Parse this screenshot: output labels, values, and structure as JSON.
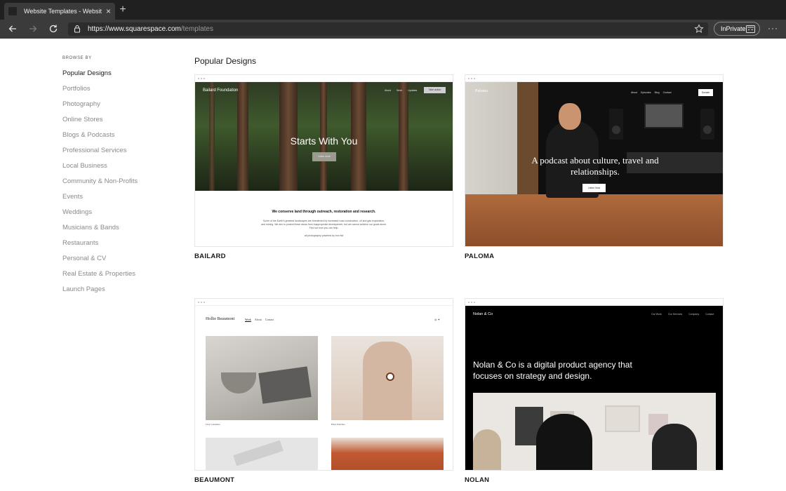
{
  "browser": {
    "tab_title": "Website Templates - Website Design",
    "tab_close": "×",
    "new_tab": "+",
    "url_host": "https://www.squarespace.com",
    "url_path": "/templates",
    "inprivate_label": "InPrivate",
    "menu": "···"
  },
  "sidebar": {
    "heading": "BROWSE BY",
    "categories": [
      "Popular Designs",
      "Portfolios",
      "Photography",
      "Online Stores",
      "Blogs & Podcasts",
      "Professional Services",
      "Local Business",
      "Community & Non-Profits",
      "Events",
      "Weddings",
      "Musicians & Bands",
      "Restaurants",
      "Personal & CV",
      "Real Estate & Properties",
      "Launch Pages"
    ]
  },
  "main": {
    "section_title": "Popular Designs",
    "templates": [
      {
        "name": "BAILARD",
        "brand": "Bailard Foundation",
        "nav": [
          "About",
          "Work",
          "Updates"
        ],
        "cta": "Take action",
        "heading": "Starts With You",
        "button": "Learn more",
        "subheading": "We conserve land through outreach, restoration and research.",
        "paragraph": "Some of the Earth's greatest landscapes are threatened by increased road construction, oil and gas exploration, and mining. We aim to protect these areas from inappropriate development, but we cannot achieve our goals alone. Find out how you can help.",
        "credit": "all photography powered by iron fist"
      },
      {
        "name": "PALOMA",
        "brand": "Paloma",
        "nav": [
          "About",
          "Episodes",
          "Blog",
          "Contact"
        ],
        "cta": "Donate",
        "heading": "A podcast about culture, travel and relationships.",
        "button": "Listen Now"
      },
      {
        "name": "BEAUMONT",
        "brand": "Hollie Beaumont",
        "nav": [
          "Work",
          "About",
          "Contact"
        ],
        "social": "◎ ✦",
        "captions": [
          "Clay Ceramics",
          "Elise Watches"
        ]
      },
      {
        "name": "NOLAN",
        "brand": "Nolan & Co",
        "nav": [
          "Our Work",
          "Our Services",
          "Company",
          "Contact"
        ],
        "heading": "Nolan & Co is a digital product agency that focuses on strategy and design."
      }
    ]
  },
  "colors": {
    "tabbar": "#202020",
    "toolbar": "#3b3b3b",
    "sidebar_text": "#8a8a8a",
    "active_text": "#1a1a1a"
  },
  "icons": [
    "back-arrow-icon",
    "forward-arrow-icon",
    "refresh-icon",
    "lock-icon",
    "star-icon",
    "inprivate-icon",
    "more-menu-icon"
  ]
}
